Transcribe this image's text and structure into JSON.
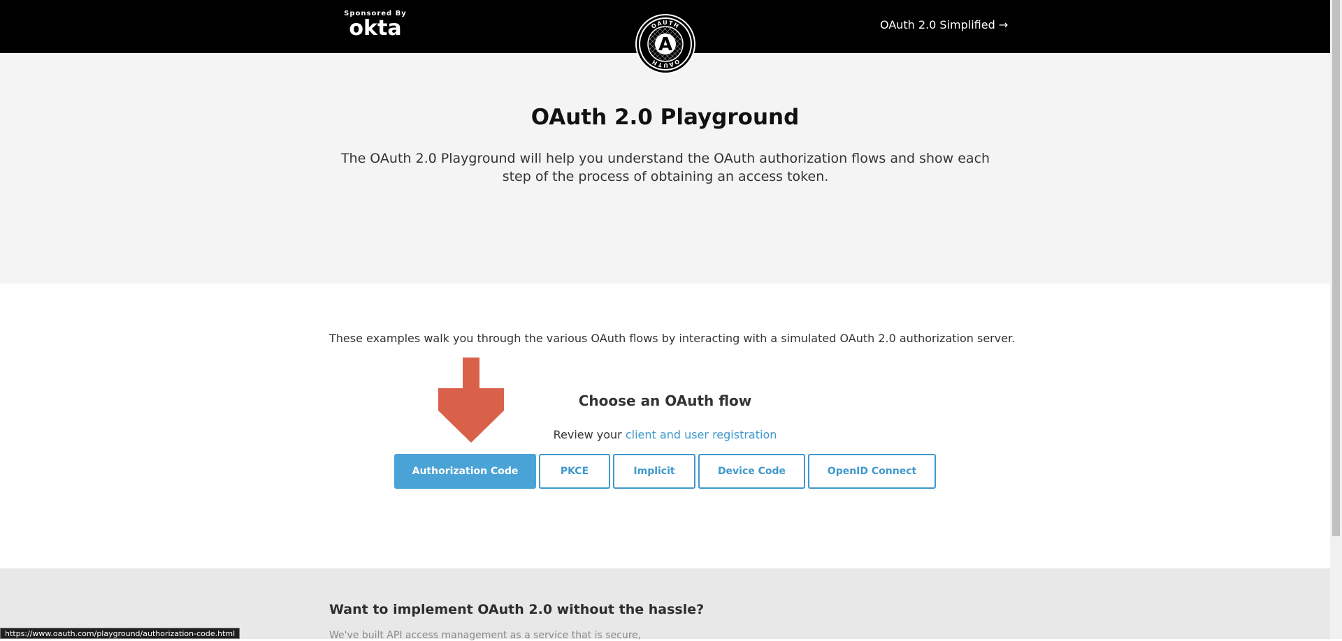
{
  "header": {
    "sponsor_label": "Sponsored By",
    "sponsor_brand": "okta",
    "logo_icon": "oauth-logo-icon",
    "logo_ring_top": "OAUTH",
    "logo_ring_bottom": "OAUTH",
    "logo_letter": "A",
    "nav_link": "OAuth 2.0 Simplified →"
  },
  "hero": {
    "title": "OAuth 2.0 Playground",
    "description": "The OAuth 2.0 Playground will help you understand the OAuth authorization flows and show each step of the process of obtaining an access token."
  },
  "main": {
    "intro": "These examples walk you through the various OAuth flows by interacting with a simulated OAuth 2.0 authorization server.",
    "choose_label": "Choose an OAuth flow",
    "review_prefix": "Review your",
    "review_link": "client and user registration",
    "arrow_icon": "arrow-down-icon",
    "arrow_color": "#d9614a",
    "flows": [
      {
        "label": "Authorization Code",
        "active": true
      },
      {
        "label": "PKCE",
        "active": false
      },
      {
        "label": "Implicit",
        "active": false
      },
      {
        "label": "Device Code",
        "active": false
      },
      {
        "label": "OpenID Connect",
        "active": false
      }
    ]
  },
  "promo": {
    "title": "Want to implement OAuth 2.0 without the hassle?",
    "text": "We've built API access management as a service that is secure,"
  },
  "status_bar": {
    "url": "https://www.oauth.com/playground/authorization-code.html"
  },
  "colors": {
    "accent": "#3f98cc",
    "header_bg": "#000000",
    "hero_bg": "#f4f4f4",
    "promo_bg": "#e8e8e9"
  }
}
